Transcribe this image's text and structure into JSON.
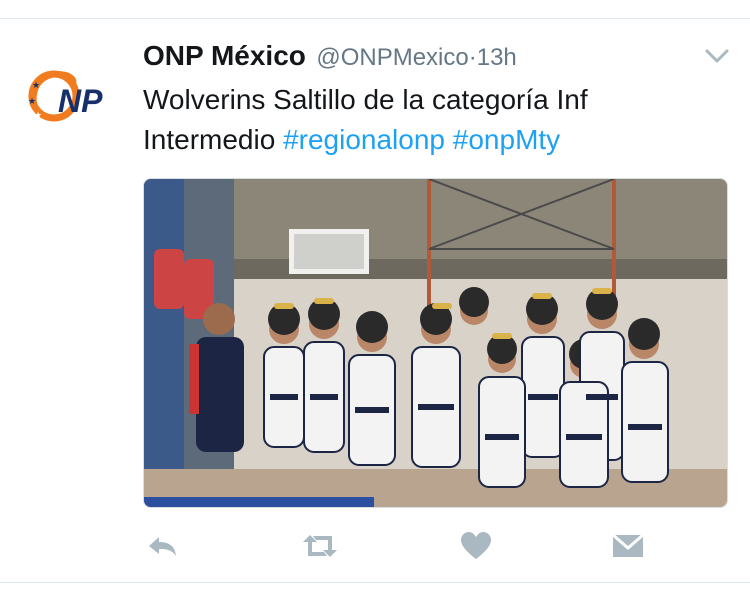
{
  "tweet": {
    "display_name": "ONP México",
    "handle": "@ONPMexico",
    "separator": "·",
    "time": "13h",
    "text_prefix": "Wolverins Saltillo de la categoría Inf Intermedio ",
    "hashtags": [
      "#regionalonp",
      "#onpMty"
    ],
    "avatar_logo_text": "ONP"
  },
  "icons": {
    "menu": "chevron-down-icon",
    "reply": "reply-icon",
    "retweet": "retweet-icon",
    "like": "heart-icon",
    "dm": "direct-message-icon"
  },
  "colors": {
    "link": "#1da1f2",
    "text": "#14171a",
    "muted": "#657786",
    "icon": "#aab8c2",
    "logo_orange": "#f07c1f",
    "logo_navy": "#17306b"
  }
}
